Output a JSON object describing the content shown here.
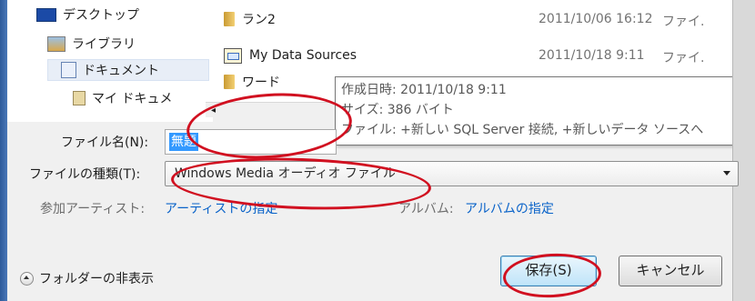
{
  "nav": {
    "items": [
      {
        "label": "デスクトップ",
        "icon": "desktop-icon"
      },
      {
        "label": "ライブラリ",
        "icon": "library-icon"
      },
      {
        "label": "ドキュメント",
        "icon": "document-library-icon"
      },
      {
        "label": "マイ ドキュメ",
        "icon": "my-documents-icon"
      }
    ]
  },
  "files": [
    {
      "name": "ラン2",
      "date": "2011/10/06 16:12",
      "type": "ファイ.",
      "icon": "folder-icon"
    },
    {
      "name": "My Data Sources",
      "date": "2011/10/18 9:11",
      "type": "ファイ.",
      "icon": "data-sources-folder-icon"
    },
    {
      "name": "ワード",
      "date": "",
      "type": "",
      "icon": "folder-icon"
    }
  ],
  "tooltip": {
    "created": "作成日時: 2011/10/18 9:11",
    "size": "サイズ: 386 バイト",
    "files": "ファイル: +新しい SQL Server 接続, +新しいデータ ソースへ"
  },
  "form": {
    "filename_label": "ファイル名(N):",
    "filename_value": "無題",
    "filetype_label": "ファイルの種類(T):",
    "filetype_value": "Windows Media オーディオ ファイル",
    "artist_label": "参加アーティスト:",
    "artist_link": "アーティストの指定",
    "album_label": "アルバム:",
    "album_link": "アルバムの指定"
  },
  "buttons": {
    "save": "保存(S)",
    "cancel": "キャンセル",
    "hide_folders": "フォルダーの非表示"
  },
  "colors": {
    "selection": "#3399ff",
    "link": "#0a63c9",
    "annotation": "#d11020"
  }
}
